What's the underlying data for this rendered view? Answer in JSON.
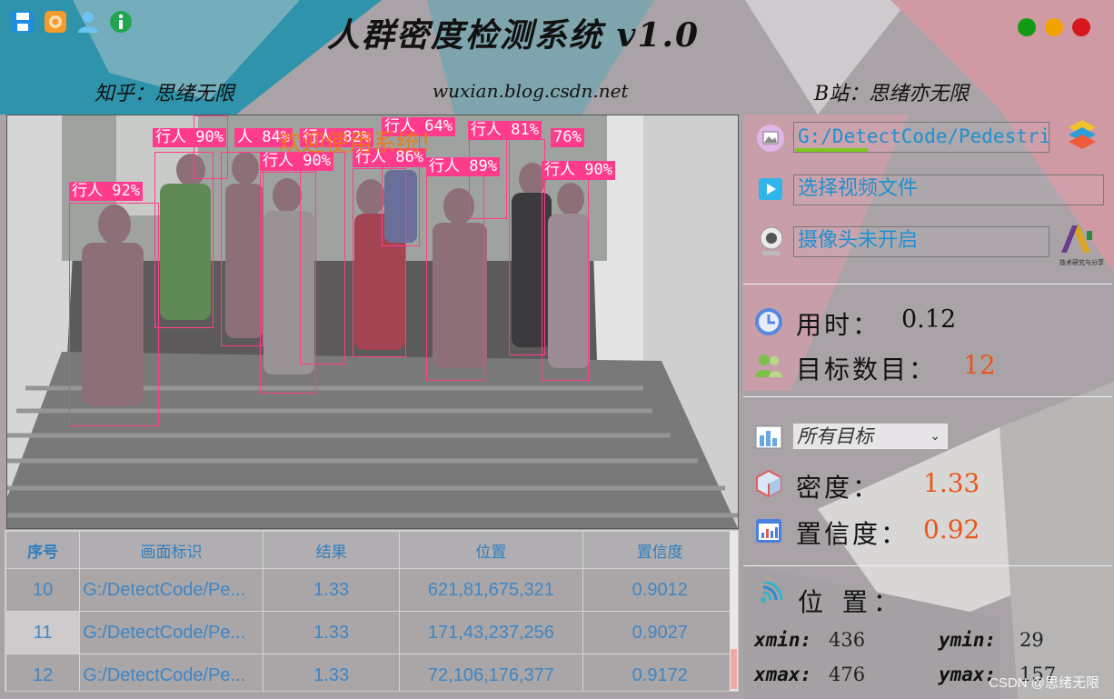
{
  "header": {
    "title": "人群密度检测系统  v1.0",
    "zhihu": "知乎：思绪无限",
    "blog": "wuxian.blog.csdn.net",
    "bili": "B站：思绪亦无限",
    "icons": [
      "save-icon",
      "camera-lens-icon",
      "user-icon",
      "info-icon"
    ],
    "window_dots": [
      "#129b12",
      "#f3a300",
      "#d8161e"
    ]
  },
  "video": {
    "overlay_text": "欢迎使用系统！",
    "detections": [
      {
        "label": "行人 92%"
      },
      {
        "label": "行人 90%"
      },
      {
        "label": "人 84%"
      },
      {
        "label": "行人 82%"
      },
      {
        "label": "行人 90%"
      },
      {
        "label": "行人 86%"
      },
      {
        "label": "行人 64%"
      },
      {
        "label": "行人 89%"
      },
      {
        "label": "行人 81%"
      },
      {
        "label": "76%"
      },
      {
        "label": "行人 90%"
      }
    ]
  },
  "panel": {
    "image_path": "G:/DetectCode/Pedestrian",
    "video_button": "选择视频文件",
    "camera_button": "摄像头未开启",
    "logo_caption": "技术研究与分享",
    "time_label": "用时：",
    "time_value": "0.12",
    "count_label": "目标数目：",
    "count_value": "12",
    "target_select": "所有目标",
    "density_label": "密度：",
    "density_value": "1.33",
    "confidence_label": "置信度：",
    "confidence_value": "0.92",
    "position_label": "位 置：",
    "xmin_label": "xmin:",
    "xmin_value": "436",
    "ymin_label": "ymin:",
    "ymin_value": "29",
    "xmax_label": "xmax:",
    "xmax_value": "476",
    "ymax_label": "ymax:",
    "ymax_value": "157",
    "accent": "#e8561a"
  },
  "table": {
    "headers": [
      "序号",
      "画面标识",
      "结果",
      "位置",
      "置信度"
    ],
    "rows": [
      [
        "10",
        "G:/DetectCode/Pe...",
        "1.33",
        "621,81,675,321",
        "0.9012"
      ],
      [
        "11",
        "G:/DetectCode/Pe...",
        "1.33",
        "171,43,237,256",
        "0.9027"
      ],
      [
        "12",
        "G:/DetectCode/Pe...",
        "1.33",
        "72,106,176,377",
        "0.9172"
      ]
    ]
  },
  "watermark": "CSDN @思绪无限"
}
